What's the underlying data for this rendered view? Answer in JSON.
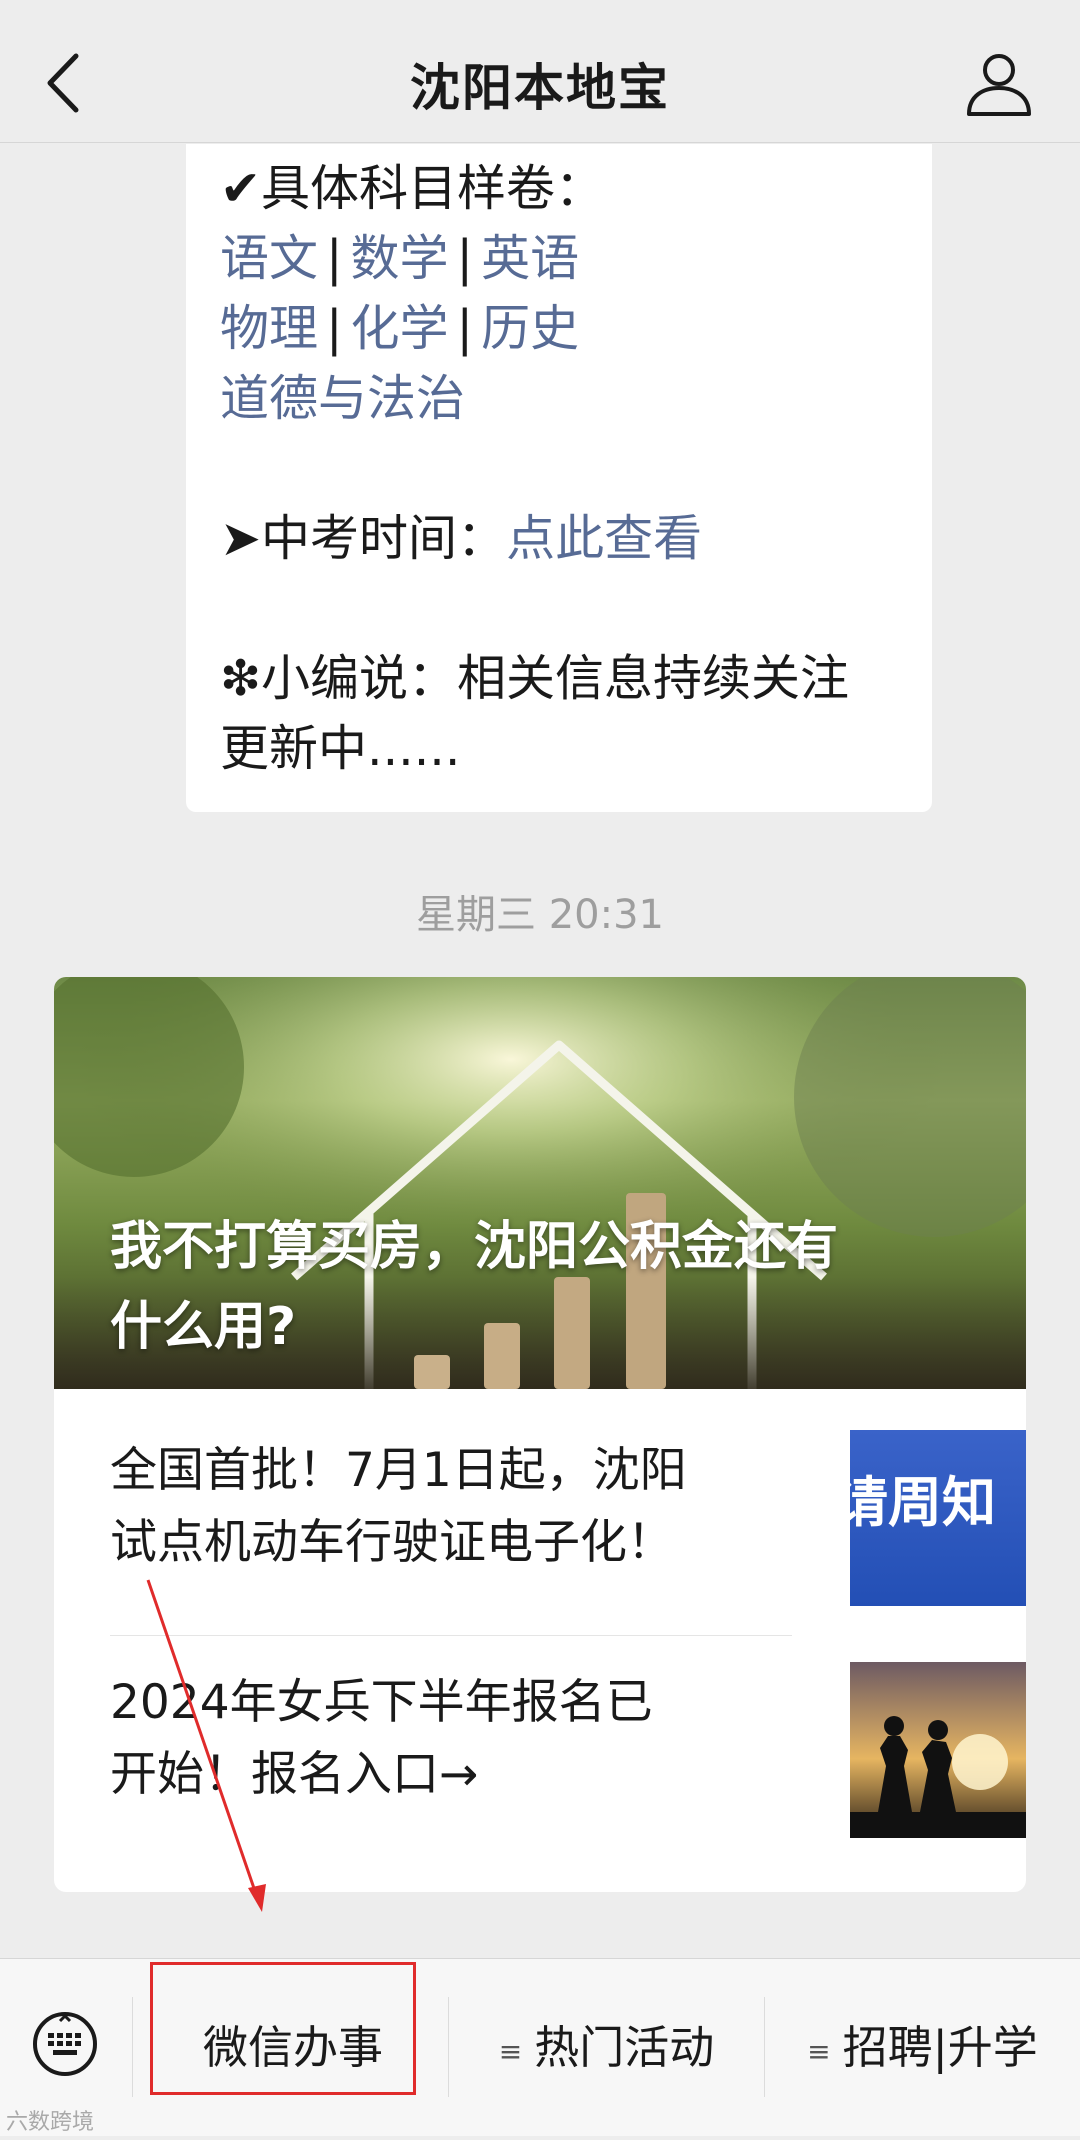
{
  "header": {
    "title": "沈阳本地宝"
  },
  "message": {
    "subjects_heading": "✔具体科目样卷：",
    "subject_row1": [
      "语文",
      "数学",
      "英语"
    ],
    "subject_row2": [
      "物理",
      "化学",
      "历史"
    ],
    "subject_row3": "道德与法治",
    "separator": "|",
    "exam_time_label": "➤中考时间：",
    "exam_time_link": "点此查看",
    "editor_note_line1": "❇小编说：相关信息持续关注",
    "editor_note_line2": "更新中......"
  },
  "timestamp": "星期三 20:31",
  "article_card": {
    "cover_title_line1": "我不打算买房，沈阳公积金还有",
    "cover_title_line2": "什么用?",
    "items": [
      {
        "title_line1": "全国首批！7月1日起，沈阳",
        "title_line2": "试点机动车行驶证电子化！",
        "thumb_text": "请周知"
      },
      {
        "title_line1": "2024年女兵下半年报名已",
        "title_line2": "开始！报名入口→"
      }
    ]
  },
  "menu": {
    "items": [
      {
        "label": "微信办事",
        "has_list_icon": false
      },
      {
        "label": "热门活动",
        "has_list_icon": true
      },
      {
        "label": "招聘|升学",
        "has_list_icon": true
      }
    ],
    "list_icon_glyph": "≡"
  },
  "watermark": "六数跨境",
  "colors": {
    "link": "#576b95",
    "annotation": "#e02b2b",
    "background": "#ededed"
  }
}
